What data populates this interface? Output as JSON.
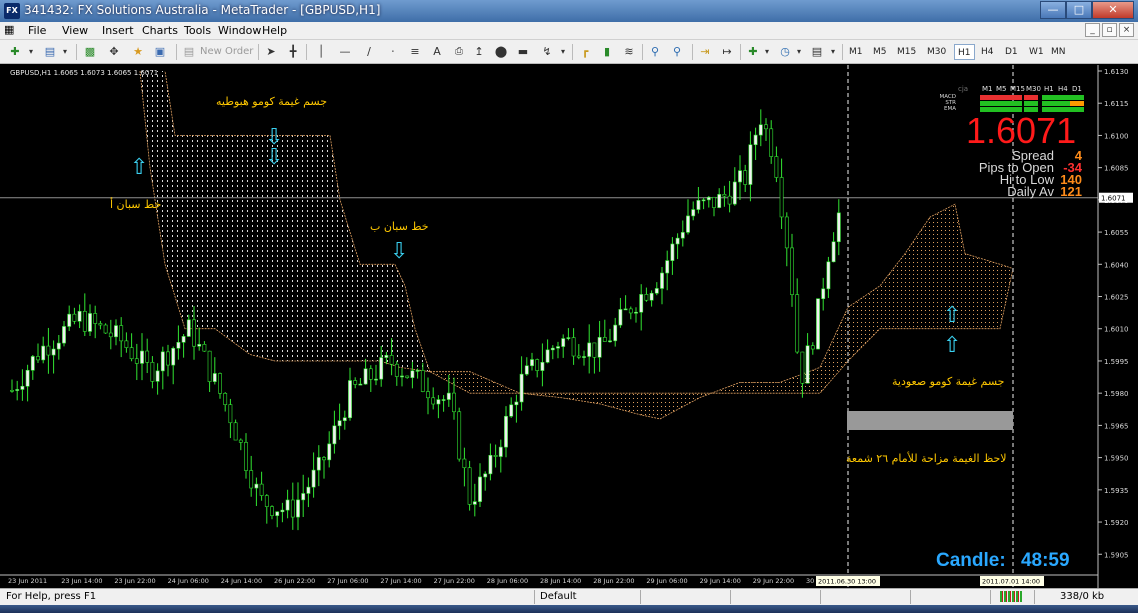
{
  "window": {
    "app_icon": "FX",
    "title": "341432: FX Solutions Australia - MetaTrader - [GBPUSD,H1]",
    "controls": [
      "minimize-icon",
      "maximize-icon",
      "close-icon"
    ]
  },
  "menu": {
    "items": [
      "File",
      "View",
      "Insert",
      "Charts",
      "Tools",
      "Window",
      "Help"
    ],
    "mdi_controls": [
      "_",
      "▫",
      "×"
    ]
  },
  "toolbar": {
    "new_order_label": "New Order",
    "text_tool": "A",
    "timeframes": [
      "M1",
      "M5",
      "M15",
      "M30",
      "H1",
      "H4",
      "D1",
      "W1",
      "MN"
    ],
    "active_timeframe": "H1"
  },
  "chart": {
    "symbol_header": "GBPUSD,H1  1.6065 1.6073 1.6065 1.6071",
    "current_price": "1.6071",
    "current_price_value": 1.6071,
    "y_axis": {
      "min": 1.59,
      "max": 1.613,
      "ticks": [
        "1.6130",
        "1.6115",
        "1.6100",
        "1.6085",
        "1.6070",
        "1.6055",
        "1.6040",
        "1.6025",
        "1.6010",
        "1.5995",
        "1.5980",
        "1.5965",
        "1.5950",
        "1.5935",
        "1.5920",
        "1.5905"
      ]
    },
    "x_axis_labels": [
      "23 Jun 2011",
      "23 Jun 14:00",
      "23 Jun 22:00",
      "24 Jun 06:00",
      "24 Jun 14:00",
      "26 Jun 22:00",
      "27 Jun 06:00",
      "27 Jun 14:00",
      "27 Jun 22:00",
      "28 Jun 06:00",
      "28 Jun 14:00",
      "28 Jun 22:00",
      "29 Jun 06:00",
      "29 Jun 14:00",
      "29 Jun 22:00",
      "30 J"
    ],
    "x_axis_highlight_1": "2011.06.30 13:00",
    "x_axis_highlight_2": "2011.07.01 14:00",
    "panel": {
      "header_labels": [
        "cja",
        "M1",
        "M5",
        "M15",
        "M30",
        "H1",
        "H4",
        "D1"
      ],
      "rows": [
        {
          "name": "MACD",
          "colors": [
            "#e83030",
            "#e83030",
            "#e83030",
            "#e83030",
            "#22c022",
            "#22c022",
            "#22c022"
          ]
        },
        {
          "name": "STR",
          "colors": [
            "#22c022",
            "#22c022",
            "#22c022",
            "#22c022",
            "#22c022",
            "#22c022",
            "#ff9900"
          ]
        },
        {
          "name": "EMA",
          "colors": [
            "#22c022",
            "#22c022",
            "#22c022",
            "#22c022",
            "#22c022",
            "#22c022",
            "#22c022"
          ]
        }
      ],
      "big_price": "1.6071",
      "stats": [
        {
          "label": "Spread",
          "value": "4"
        },
        {
          "label": "Pips to Open",
          "value": "-34"
        },
        {
          "label": "Hi to Low",
          "value": "140"
        },
        {
          "label": "Daily Av",
          "value": "121"
        }
      ]
    },
    "annotations": {
      "bearish_cloud": "جسم غيمة كومو هبوطيه",
      "span_a": "خط سبان أ",
      "span_b": "خط سبان ب",
      "bullish_cloud": "جسم غيمة كومو صعودية",
      "shift_note": "لاحظ الغيمة مزاحة للأمام ٢٦ شمعة"
    },
    "candle_timer_label": "Candle:",
    "candle_timer_value": "48:59",
    "colors": {
      "candle_up": "#f0f0f0",
      "candle_down": "#000000",
      "wick": "#32e632",
      "cloud": "#e0a060",
      "price_text": "#ff1a1a",
      "annotation": "#ffc800",
      "arrow": "#3ad0f0",
      "timer": "#2aa8ff"
    }
  },
  "status": {
    "help": "For Help, press F1",
    "profile": "Default",
    "traffic": "338/0 kb"
  }
}
